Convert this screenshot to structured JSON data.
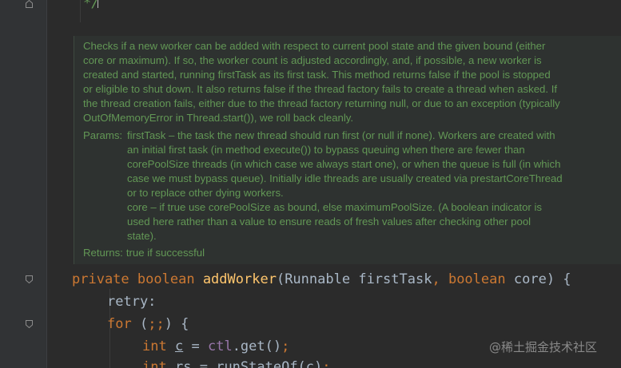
{
  "top_comment": "*/",
  "doc": {
    "summary": "Checks if a new worker can be added with respect to current pool state and the given bound (either core or maximum). If so, the worker count is adjusted accordingly, and, if possible, a new worker is created and started, running firstTask as its first task. This method returns false if the pool is stopped or eligible to shut down. It also returns false if the thread factory fails to create a thread when asked. If the thread creation fails, either due to the thread factory returning null, or due to an exception (typically OutOfMemoryError in Thread.start()), we roll back cleanly.",
    "params_label": "Params:",
    "param_first_task": "firstTask – the task the new thread should run first (or null if none). Workers are created with an initial first task (in method execute()) to bypass queuing when there are fewer than corePoolSize threads (in which case we always start one), or when the queue is full (in which case we must bypass queue). Initially idle threads are usually created via prestartCoreThread or to replace other dying workers.",
    "param_core": "core – if true use corePoolSize as bound, else maximumPoolSize. (A boolean indicator is used here rather than a value to ensure reads of fresh values after checking other pool state).",
    "returns_label": "Returns:",
    "returns_text": "true if successful"
  },
  "code": {
    "line1": {
      "kw_private": "private",
      "kw_boolean": "boolean",
      "method_name": "addWorker",
      "paren_open": "(",
      "param1_type": "Runnable",
      "param1_name": "firstTask",
      "comma": ",",
      "kw_boolean2": "boolean",
      "param2_name": "core",
      "paren_close_brace": ") {"
    },
    "line2": {
      "label": "retry:"
    },
    "line3": {
      "kw_for": "for",
      "open": "(",
      "semis": ";;",
      "close_brace": ") {"
    },
    "line4": {
      "kw_int": "int",
      "var_c": "c",
      "eq": "=",
      "field_ctl": "ctl",
      "call": ".get()",
      "semi": ";"
    },
    "line5": {
      "kw_int": "int",
      "var_rs": "rs",
      "eq": "=",
      "call": "runStateOf(c)",
      "semi": ";"
    }
  },
  "watermark": "@稀土掘金技术社区",
  "colors": {
    "background": "#2b2b2b",
    "gutter": "#313335",
    "doc_text": "#629755",
    "keyword": "#cc7832",
    "method": "#ffc66d",
    "field": "#9876aa",
    "default_text": "#a9b7c6"
  }
}
